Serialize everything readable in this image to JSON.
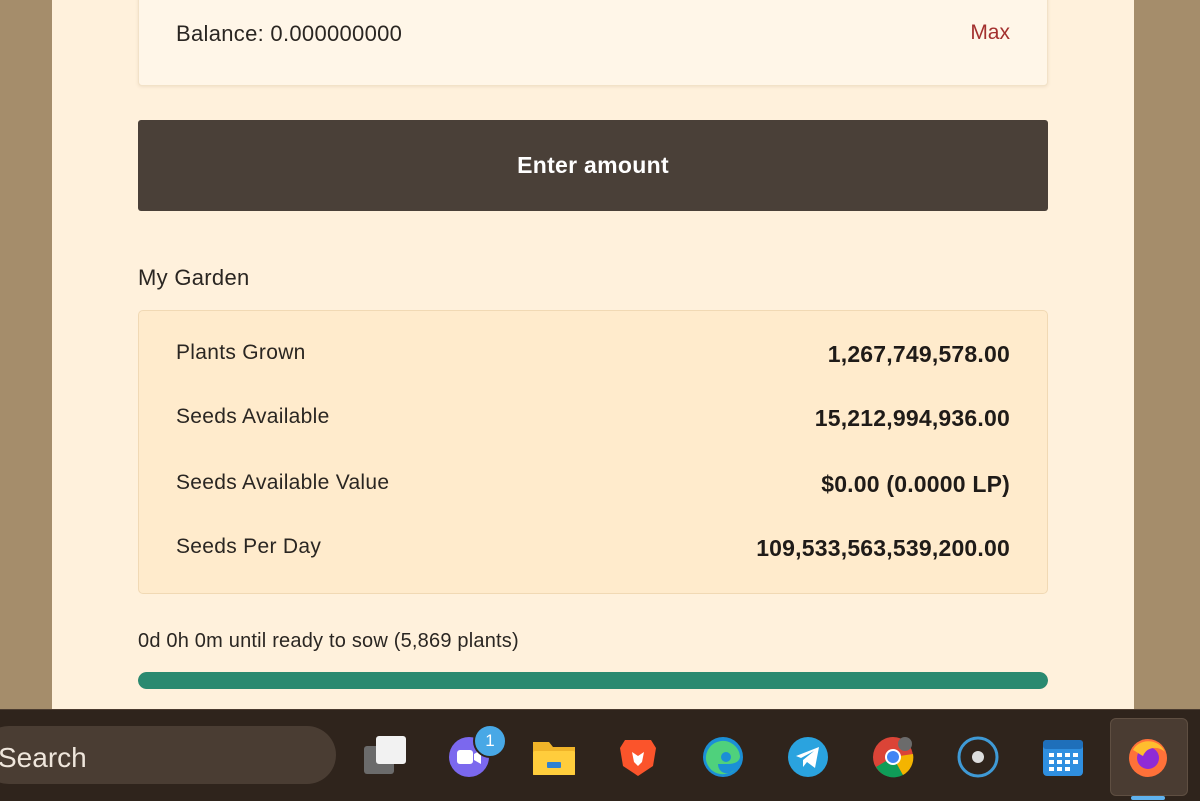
{
  "balance_card": {
    "balance_text": "Balance: 0.000000000",
    "max_label": "Max"
  },
  "enter_button": {
    "label": "Enter amount"
  },
  "garden": {
    "title": "My Garden",
    "rows": [
      {
        "label": "Plants Grown",
        "value": "1,267,749,578.00"
      },
      {
        "label": "Seeds Available",
        "value": "15,212,994,936.00"
      },
      {
        "label": "Seeds Available Value",
        "value": "$0.00 (0.0000 LP)"
      },
      {
        "label": "Seeds Per Day",
        "value": "109,533,563,539,200.00"
      }
    ]
  },
  "countdown": {
    "text": "0d 0h 0m until ready to sow (5,869 plants)",
    "progress": 1.0
  },
  "taskbar": {
    "search_label": "Search",
    "teams_badge": "1",
    "icons": [
      "task-view-icon",
      "teams-icon",
      "file-explorer-icon",
      "brave-icon",
      "edge-icon",
      "telegram-icon",
      "chrome-icon",
      "cortana-icon",
      "calendar-icon",
      "firefox-icon"
    ]
  },
  "colors": {
    "panel": "#fff1dc",
    "button": "#4a4038",
    "max_link": "#a3302e",
    "progress": "#2a8a70",
    "taskbar": "#2f241c"
  }
}
